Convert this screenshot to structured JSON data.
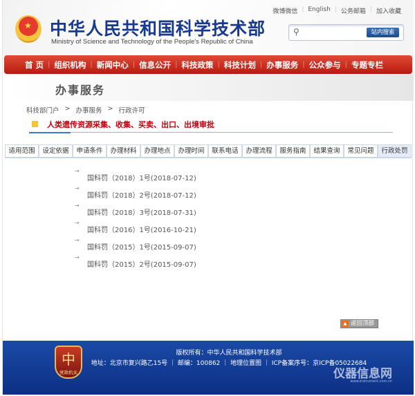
{
  "header": {
    "title_cn": "中华人民共和国科学技术部",
    "title_en": "Ministry of Science and Technology of the People's Republic of China",
    "top_links": [
      "微博微信",
      "English",
      "公务邮箱",
      "加入收藏"
    ],
    "search": {
      "placeholder": "",
      "button": "站内搜索"
    }
  },
  "nav": [
    "首 页",
    "组织机构",
    "新闻中心",
    "信息公开",
    "科技政策",
    "科技计划",
    "办事服务",
    "公众参与",
    "专题专栏"
  ],
  "banner": "办事服务",
  "breadcrumb": [
    "科技部门户",
    "办事服务",
    "行政许可"
  ],
  "breadcrumb_sep": ">",
  "doc_title": "人类遗传资源采集、收集、买卖、出口、出境审批",
  "tabs": [
    "适用范围",
    "设定依据",
    "申请条件",
    "办理材料",
    "办理地点",
    "办理时间",
    "联系电话",
    "办理流程",
    "服务指南",
    "结果查询",
    "常见问题",
    "行政处罚"
  ],
  "active_tab": "行政处罚",
  "items": [
    "国科罚（2018）1号(2018-07-12)",
    "国科罚（2018）2号(2018-07-12)",
    "国科罚（2018）3号(2018-07-31)",
    "国科罚（2016）1号(2016-10-21)",
    "国科罚（2015）1号(2015-09-07)",
    "国科罚（2015）2号(2015-09-07)"
  ],
  "back_to_top": "返回顶部",
  "footer": {
    "copyright": "版权所有：中华人民共和国科学技术部",
    "address": "地址：北京市复兴路乙15号 ｜ 邮编：100862 ｜ 地理位置图 ｜ ICP备案序号：京ICP备05022684",
    "badge": "党政机关",
    "watermark": "仪器信息网",
    "watermark_url": "www.instrument.com.cn"
  },
  "colors": {
    "nav_red": "#c8281a",
    "footer_blue": "#153f99",
    "title_blue": "#173a8f",
    "doc_title_red": "#c0000c"
  }
}
